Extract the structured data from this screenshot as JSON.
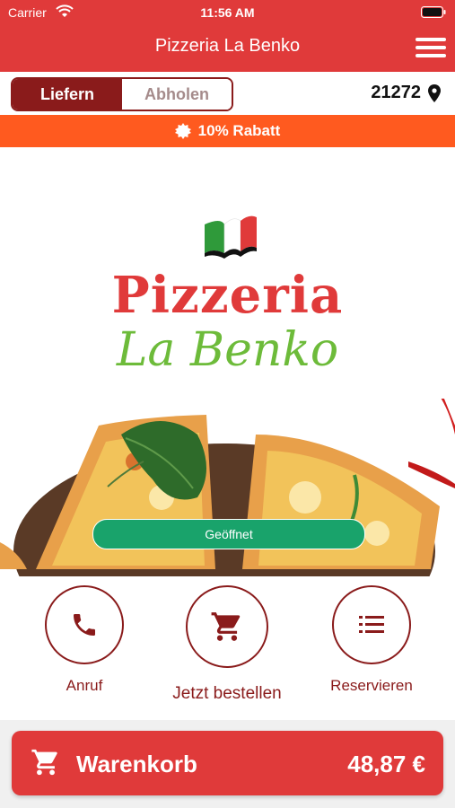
{
  "status_bar": {
    "carrier": "Carrier",
    "time": "11:56 AM"
  },
  "header": {
    "title": "Pizzeria La Benko"
  },
  "mode_toggle": {
    "delivery_label": "Liefern",
    "pickup_label": "Abholen",
    "selected": "Liefern"
  },
  "location": {
    "zip": "21272"
  },
  "promo": {
    "text": "10% Rabatt"
  },
  "logo": {
    "line1": "Pizzeria",
    "line2": "La Benko"
  },
  "status_badge": {
    "label": "Geöffnet"
  },
  "actions": {
    "call_label": "Anruf",
    "order_label": "Jetzt bestellen",
    "reserve_label": "Reservieren"
  },
  "cart": {
    "label": "Warenkorb",
    "total": "48,87 €"
  },
  "colors": {
    "primary": "#e03a3a",
    "dark_red": "#8a1b1b",
    "promo": "#ff5a1f",
    "open_green": "#19a36b",
    "logo_green": "#6dbb3a"
  },
  "icons": {
    "menu": "hamburger-icon",
    "zip": "map-pin-icon",
    "promo": "badge-icon",
    "call": "phone-icon",
    "order": "cart-icon",
    "reserve": "list-icon",
    "cart": "cart-icon"
  }
}
